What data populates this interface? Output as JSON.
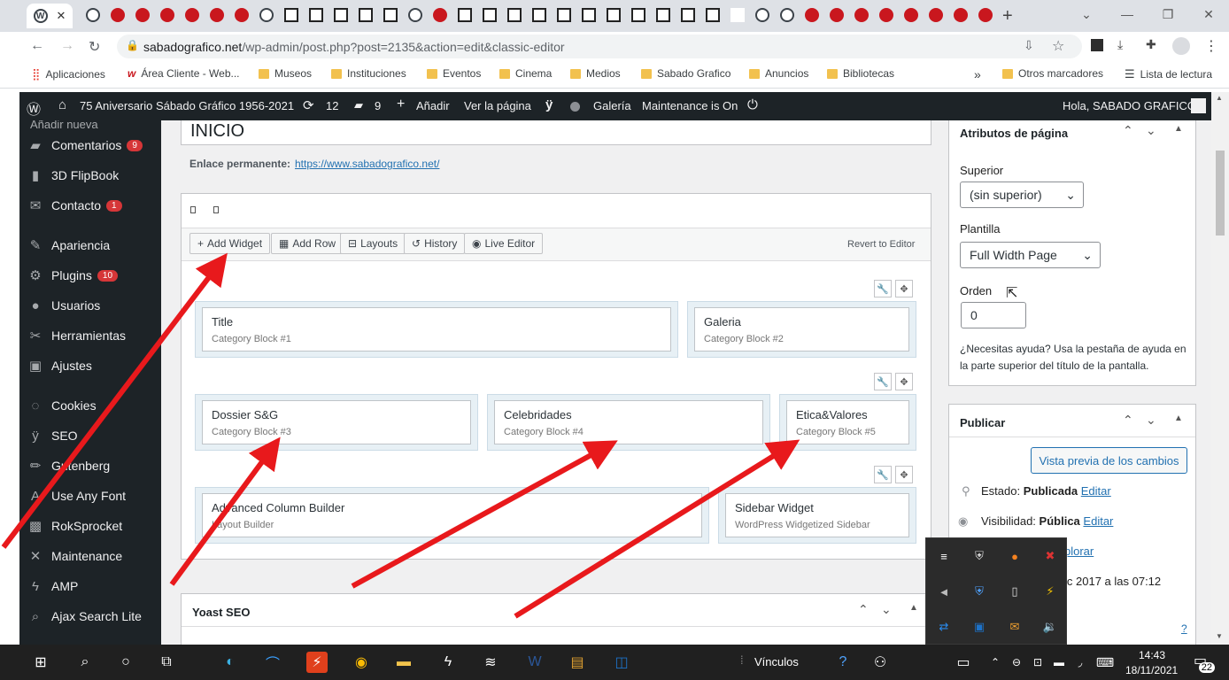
{
  "browser": {
    "active_tab_close": "✕",
    "new_tab": "+",
    "url_host": "sabadografico.net",
    "url_path": "/wp-admin/post.php?post=2135&action=edit&classic-editor"
  },
  "bookmarks": {
    "apps": "Aplicaciones",
    "items": [
      "Área Cliente - Web...",
      "Museos",
      "Instituciones",
      "Eventos",
      "Cinema",
      "Medios",
      "Sabado Grafico",
      "Anuncios",
      "Bibliotecas"
    ],
    "more": "»",
    "other": "Otros marcadores",
    "reading_list": "Lista de lectura"
  },
  "adminbar": {
    "site": "75 Aniversario Sábado Gráfico 1956-2021",
    "updates": "12",
    "comments": "9",
    "add": "Añadir",
    "view": "Ver la página",
    "gallery": "Galería",
    "maintenance": "Maintenance is On",
    "greeting": "Hola, SABADO GRAFICO"
  },
  "sidebar": {
    "add_new": "Añadir nueva",
    "items": [
      {
        "label": "Comentarios",
        "badge": "9",
        "icon": "comment-icon"
      },
      {
        "label": "3D FlipBook",
        "icon": "book-icon"
      },
      {
        "label": "Contacto",
        "badge": "1",
        "icon": "mail-icon"
      },
      {
        "label": "Apariencia",
        "icon": "brush-icon"
      },
      {
        "label": "Plugins",
        "badge": "10",
        "icon": "plugin-icon"
      },
      {
        "label": "Usuarios",
        "icon": "user-icon"
      },
      {
        "label": "Herramientas",
        "icon": "wrench-icon"
      },
      {
        "label": "Ajustes",
        "icon": "settings-icon"
      },
      {
        "label": "Cookies",
        "icon": "cookie-icon"
      },
      {
        "label": "SEO",
        "icon": "yoast-icon"
      },
      {
        "label": "Gutenberg",
        "icon": "pencil-icon"
      },
      {
        "label": "Use Any Font",
        "icon": "font-icon"
      },
      {
        "label": "RokSprocket",
        "icon": "rocket-icon"
      },
      {
        "label": "Maintenance",
        "icon": "tools-icon"
      },
      {
        "label": "AMP",
        "icon": "amp-icon"
      },
      {
        "label": "Ajax Search Lite",
        "icon": "search-icon"
      }
    ]
  },
  "editor": {
    "title": "INICIO",
    "permalink_label": "Enlace permanente:",
    "permalink_url": "https://www.sabadografico.net/",
    "toolbar": {
      "add_widget": "Add Widget",
      "add_row": "Add Row",
      "layouts": "Layouts",
      "history": "History",
      "live_editor": "Live Editor",
      "revert": "Revert to Editor"
    },
    "rows": [
      [
        {
          "title": "Title",
          "sub": "Category Block #1"
        },
        {
          "title": "Galeria",
          "sub": "Category Block #2"
        }
      ],
      [
        {
          "title": "Dossier S&G",
          "sub": "Category Block #3"
        },
        {
          "title": "Celebridades",
          "sub": "Category Block #4"
        },
        {
          "title": "Etica&Valores",
          "sub": "Category Block #5"
        }
      ],
      [
        {
          "title": "Advanced Column Builder",
          "sub": "Layout Builder"
        },
        {
          "title": "Sidebar Widget",
          "sub": "WordPress Widgetized Sidebar"
        }
      ]
    ],
    "yoast": "Yoast SEO"
  },
  "page_attributes": {
    "heading": "Atributos de página",
    "parent_label": "Superior",
    "parent_value": "(sin superior)",
    "template_label": "Plantilla",
    "template_value": "Full Width Page",
    "order_label": "Orden",
    "order_value": "0",
    "help": "¿Necesitas ayuda? Usa la pestaña de ayuda en la parte superior del título de la pantalla."
  },
  "publish": {
    "heading": "Publicar",
    "preview": "Vista previa de los cambios",
    "status_label": "Estado:",
    "status_value": "Publicada",
    "edit": "Editar",
    "visibility_label": "Visibilidad:",
    "visibility_value": "Pública",
    "explore": "plorar",
    "date": "ic 2017 a las 07:12",
    "help": "?"
  },
  "taskbar": {
    "links": "Vínculos",
    "time": "14:43",
    "date": "18/11/2021",
    "notifications": "22"
  },
  "colors": {
    "wp_dark": "#1d2327",
    "wp_badge": "#d63638",
    "link": "#2271b1",
    "arrow": "#e8191c"
  }
}
